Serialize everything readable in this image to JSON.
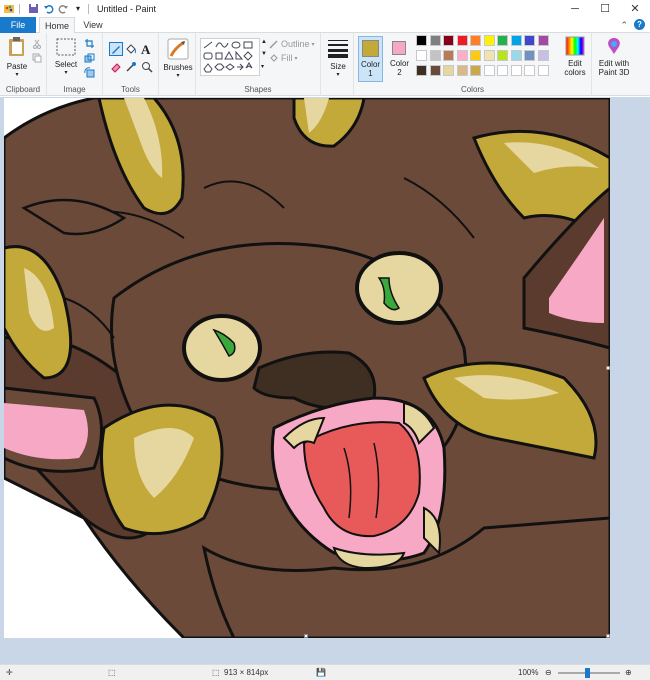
{
  "window": {
    "title": "Untitled - Paint"
  },
  "tabs": {
    "file": "File",
    "home": "Home",
    "view": "View"
  },
  "clipboard": {
    "paste_label": "Paste",
    "group_label": "Clipboard"
  },
  "image": {
    "select_label": "Select",
    "group_label": "Image"
  },
  "tools": {
    "group_label": "Tools"
  },
  "brushes": {
    "label": "Brushes"
  },
  "shapes": {
    "outline_label": "Outline",
    "fill_label": "Fill",
    "group_label": "Shapes"
  },
  "size": {
    "label": "Size"
  },
  "colors": {
    "color1_label": "Color\n1",
    "color2_label": "Color\n2",
    "color1_value": "#c3a83a",
    "color2_value": "#f7a8c4",
    "edit_label": "Edit\ncolors",
    "group_label": "Colors",
    "palette_row1": [
      "#000000",
      "#7f7f7f",
      "#880015",
      "#ed1c24",
      "#ff7f27",
      "#fff200",
      "#22b14c",
      "#00a2e8",
      "#3f48cc",
      "#a349a4"
    ],
    "palette_row2": [
      "#ffffff",
      "#c3c3c3",
      "#b97a57",
      "#ffaec9",
      "#ffc90e",
      "#efe4b0",
      "#b5e61d",
      "#99d9ea",
      "#7092be",
      "#c8bfe7"
    ],
    "palette_row3": [
      "#3f2e22",
      "#6b4a3a",
      "#e6d7a0",
      "#d9b98a",
      "#c9a94c",
      "#ffffff",
      "#ffffff",
      "#ffffff",
      "#ffffff",
      "#ffffff"
    ]
  },
  "paint3d": {
    "label": "Edit with\nPaint 3D"
  },
  "status": {
    "dimensions": "913 × 814px",
    "zoom": "100%"
  }
}
